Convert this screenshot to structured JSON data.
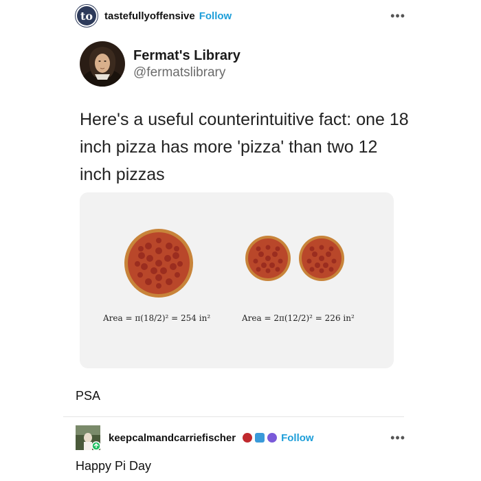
{
  "post": {
    "username": "tastefullyoffensive",
    "avatar_text": "to",
    "follow_label": "Follow",
    "more_label": "•••"
  },
  "tweet": {
    "author_name": "Fermat's Library",
    "author_handle": "@fermatslibrary",
    "text": "Here's a useful counterintuitive fact: one 18 inch pizza has more 'pizza' than two 12 inch pizzas"
  },
  "figure": {
    "formula_left": "Area = π(18/2)² = 254 in²",
    "formula_right": "Area = 2π(12/2)² = 226 in²"
  },
  "caption": "PSA",
  "reblog": {
    "username": "keepcalmandcarriefischer",
    "follow_label": "Follow",
    "more_label": "•••",
    "text": "Happy Pi Day"
  },
  "colors": {
    "follow": "#1d9ed9",
    "crust": "#c8843a",
    "sauce": "#b9472a",
    "pepperoni": "#9b2d1f"
  },
  "icons": [
    "more-icon",
    "reblog-icon",
    "badge-icon"
  ]
}
